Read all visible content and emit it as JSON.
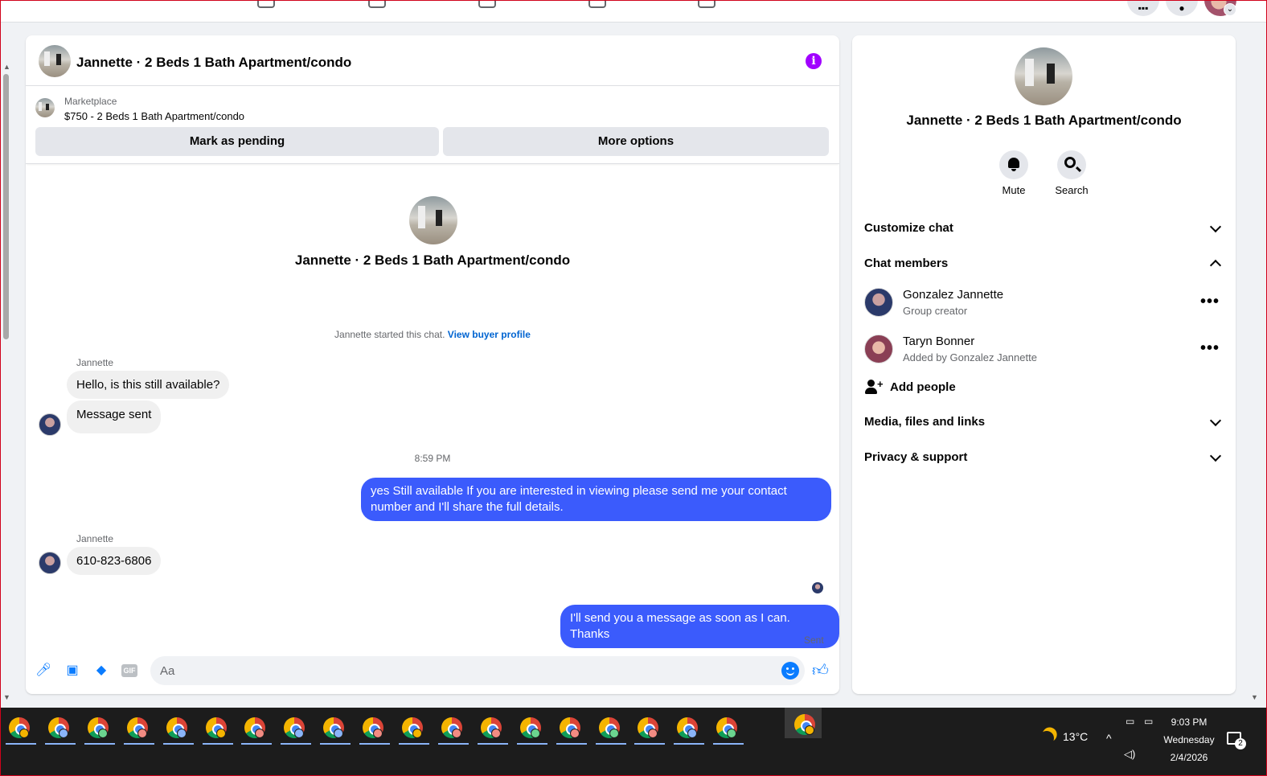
{
  "chat": {
    "title": "Jannette · 2 Beds 1 Bath Apartment/condo",
    "marketplace_label": "Marketplace",
    "listing": "$750 - 2 Beds 1 Bath Apartment/condo",
    "mark_pending": "Mark as pending",
    "more_options": "More options",
    "center_title": "Jannette · 2 Beds 1 Bath Apartment/condo",
    "started_text": "Jannette started this chat.",
    "view_buyer": "View buyer profile",
    "messages": [
      {
        "sender": "Jannette",
        "text": "Hello, is this still available?"
      },
      {
        "text": "Message sent"
      },
      {
        "timestamp": "8:59 PM"
      },
      {
        "text": "yes Still available If you are interested in viewing please send me your contact number and I'll share the full details."
      },
      {
        "sender": "Jannette",
        "text": "610-823-6806"
      },
      {
        "text": "I'll send you a message as soon as I can. Thanks"
      }
    ],
    "sent_status": "Sent",
    "composer_placeholder": "Aa",
    "gif_label": "GIF"
  },
  "side": {
    "name": "Jannette · 2 Beds 1 Bath Apartment/condo",
    "mute": "Mute",
    "search": "Search",
    "customize": "Customize chat",
    "members_title": "Chat members",
    "members": [
      {
        "name": "Gonzalez Jannette",
        "sub": "Group creator"
      },
      {
        "name": "Taryn Bonner",
        "sub": "Added by Gonzalez Jannette"
      }
    ],
    "add_people": "Add people",
    "media": "Media, files and links",
    "privacy": "Privacy & support"
  },
  "taskbar": {
    "temperature": "13°C",
    "time": "9:03 PM",
    "day": "Wednesday",
    "date": "2/4/2026",
    "notif_count": "2",
    "profile_colors": [
      "#f4b400",
      "#8ab4f8",
      "#6bd48f",
      "#f28b82",
      "#8ab4f8",
      "#f4b400",
      "#f28b82",
      "#8ab4f8",
      "#8ab4f8",
      "#f28b82",
      "#f4b400",
      "#f28b82",
      "#f28b82",
      "#6bd48f",
      "#f28b82",
      "#6bd48f",
      "#f28b82",
      "#8ab4f8",
      "#6bd48f",
      "#f4b400"
    ]
  }
}
